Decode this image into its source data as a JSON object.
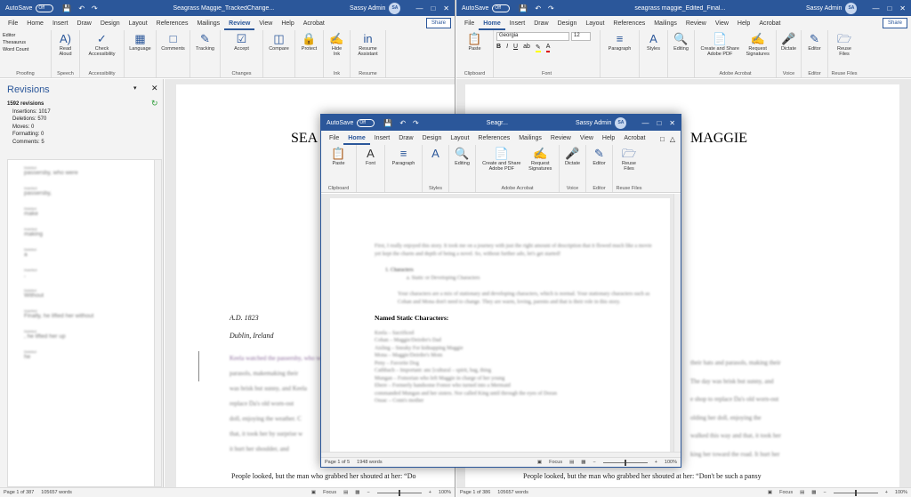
{
  "left": {
    "autosave": "AutoSave",
    "toggle": "Off",
    "title": "Seagrass Maggie_TrackedChange...",
    "user": "Sassy Admin",
    "initials": "SA",
    "share": "Share",
    "tabs": [
      "File",
      "Home",
      "Insert",
      "Draw",
      "Design",
      "Layout",
      "References",
      "Mailings",
      "Review",
      "View",
      "Help",
      "Acrobat"
    ],
    "active_tab": "Review",
    "ribbon": {
      "proof_items": [
        "Editor",
        "Thesaurus",
        "Word Count"
      ],
      "proof_label": "Proofing",
      "read_aloud": "Read Aloud",
      "speech": "Speech",
      "check_acc": "Check Accessibility",
      "accessibility": "Accessibility",
      "language": "Language",
      "comments": "Comments",
      "tracking": "Tracking",
      "accept": "Accept",
      "changes": "Changes",
      "compare": "Compare",
      "protect": "Protect",
      "hide_ink": "Hide Ink",
      "ink": "Ink",
      "resume": "Resume Assistant",
      "resume_label": "Resume"
    },
    "revisions": {
      "title": "Revisions",
      "count": "1592 revisions",
      "stats": [
        "Insertions: 1017",
        "Deletions: 570",
        "Moves: 0",
        "Formatting: 0",
        "Comments: 5"
      ],
      "entries": [
        {
          "tag": "Deleted",
          "text": "passersby, who were"
        },
        {
          "tag": "Inserted",
          "text": "passersby,"
        },
        {
          "tag": "Deleted",
          "text": "make"
        },
        {
          "tag": "Inserted",
          "text": "making"
        },
        {
          "tag": "Deleted",
          "text": "a"
        },
        {
          "tag": "Inserted",
          "text": ","
        },
        {
          "tag": "Deleted",
          "text": "Without"
        },
        {
          "tag": "Inserted",
          "text": "Finally, he lifted her without"
        },
        {
          "tag": "Deleted",
          "text": ", he lifted her up"
        },
        {
          "tag": "Deleted",
          "text": "he"
        }
      ]
    },
    "doc": {
      "title": "SEA",
      "date": "A.D. 1823",
      "place": "Dublin, Ireland",
      "lines": [
        "Keela watched the passersby, who were",
        "parasols, makemaking their",
        "was brisk but sunny, and Keela",
        "replace Da's old worn-out",
        "doll, enjoying the weather. C",
        "that, it took her by surprise w",
        "it hurt her shoulder, and"
      ],
      "bottom": "People looked, but the man who grabbed her shouted at her: “Do"
    },
    "status": {
      "page": "Page 1 of 387",
      "words": "105657 words",
      "focus": "Focus",
      "zoom": "100%"
    }
  },
  "right": {
    "autosave": "AutoSave",
    "toggle": "Off",
    "title": "seagrass maggie_Edited_Final...",
    "user": "Sassy Admin",
    "initials": "SA",
    "share": "Share",
    "tabs": [
      "File",
      "Home",
      "Insert",
      "Draw",
      "Design",
      "Layout",
      "References",
      "Mailings",
      "Review",
      "View",
      "Help",
      "Acrobat"
    ],
    "active_tab": "Home",
    "ribbon": {
      "paste": "Paste",
      "clipboard": "Clipboard",
      "font_name": "Georgia",
      "font_size": "12",
      "font": "Font",
      "paragraph": "Paragraph",
      "styles": "Styles",
      "editing": "Editing",
      "create_share": "Create and Share Adobe PDF",
      "request_sig": "Request Signatures",
      "acrobat": "Adobe Acrobat",
      "dictate": "Dictate",
      "voice": "Voice",
      "editor": "Editor",
      "editor_label": "Editor",
      "reuse": "Reuse Files",
      "reuse_label": "Reuse Files"
    },
    "doc": {
      "title": "MAGGIE",
      "lines": [
        "their hats and parasols, making their",
        "The day was brisk but sunny, and",
        "e shop to replace Da's old worn-out",
        "olding her doll, enjoying the",
        "walked this way and that, it took her",
        "king her toward the road. It hurt her"
      ],
      "bottom": "People looked, but the man who grabbed her shouted at her: “Don't be such a pansy"
    },
    "status": {
      "page": "Page 1 of 386",
      "words": "105657 words",
      "focus": "Focus",
      "zoom": "100%"
    }
  },
  "front": {
    "autosave": "AutoSave",
    "toggle": "Off",
    "title": "Seagr...",
    "user": "Sassy Admin",
    "initials": "SA",
    "tabs": [
      "File",
      "Home",
      "Insert",
      "Draw",
      "Design",
      "Layout",
      "References",
      "Mailings",
      "Review",
      "View",
      "Help",
      "Acrobat"
    ],
    "active_tab": "Home",
    "ribbon": {
      "paste": "Paste",
      "clipboard": "Clipboard",
      "font": "Font",
      "paragraph": "Paragraph",
      "styles": "Styles",
      "editing": "Editing",
      "create_share": "Create and Share Adobe PDF",
      "request_sig": "Request Signatures",
      "acrobat": "Adobe Acrobat",
      "dictate": "Dictate",
      "voice": "Voice",
      "editor": "Editor",
      "editor_label": "Editor",
      "reuse": "Reuse Files",
      "reuse_label": "Reuse Files"
    },
    "doc": {
      "intro": "First, I really enjoyed this story. It took me on a journey with just the right amount of description that it flowed much like a movie yet kept the charm and depth of being a novel. So, without further ado, let's get started!",
      "list1": "1.    Characters",
      "list2": "a.    Static or Developing Characters",
      "para": "Your characters are a mix of stationary and developing characters, which is normal. Your stationary characters such as Cohan and Mona don't need to change. They are warm, loving, parents and that is their role in this story.",
      "heading": "Named Static Characters:",
      "chars": [
        "Keela – Sacrificed",
        "Cohan – Maggie/Deirdre's Dad",
        "Aisling – Sneaky For kidnapping Maggie",
        "Mona – Maggie/Deirdre's Mom",
        "Peny – Favorite Dog",
        "Cathbach – Important: anc [cultural – spirit, bag, thing",
        "Mungan – Fomorian who left Maggie in charge of her young",
        "Ebere – Formerly handsome Fomor who turned into a Mermaid",
        "commanded Mungan and her sisters. Nor called King until through the eyes of Doran",
        "Ossac – Conn's mother"
      ]
    },
    "status": {
      "page": "Page 1 of 5",
      "words": "1948 words",
      "focus": "Focus",
      "zoom": "100%"
    }
  }
}
